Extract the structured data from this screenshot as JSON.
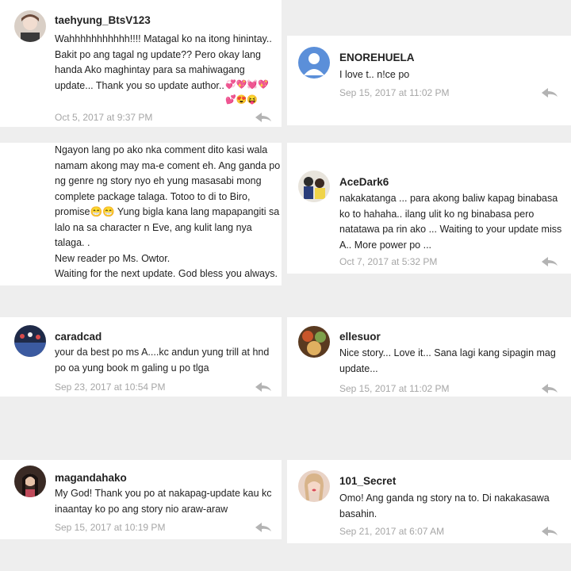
{
  "comments": [
    {
      "username": "taehyung_BtsV123",
      "body": "Wahhhhhhhhhhh!!!!  Matagal ko na itong hinintay..\nBakit po ang tagal ng update??  Pero okay lang\nhanda Ako maghintay para sa mahiwagang\nupdate...  Thank you so update author..",
      "emoji": "💞💖💓💖\n💕😍😝",
      "timestamp": "Oct 5, 2017 at 9:37 PM",
      "avatar_icon": "user-photo"
    },
    {
      "username": "ENOREHUELA",
      "body": "I love t.. n!ce po",
      "timestamp": "Sep 15, 2017 at 11:02 PM",
      "avatar_icon": "default-user-icon"
    },
    {
      "username": "",
      "body": "Ngayon lang po ako nka comment dito kasi wala\nnamam akong may ma-e coment eh. Ang ganda po\nng genre ng story nyo eh yung masasabi mong\ncomplete package talaga. Totoo to di to Biro,\npromise😁😁 Yung bigla kana lang mapapangiti sa\nlalo na sa character n Eve, ang kulit lang nya\ntalaga. .\nNew reader po Ms. Owtor.\nWaiting for the next update. God bless you always.",
      "emoji": "😁😁"
    },
    {
      "username": "AceDark6",
      "body": "nakakatanga ... para akong baliw kapag binabasa\nko to hahaha.. ilang ulit ko ng binabasa pero\nnatatawa pa rin ako ... Waiting to your update miss\nA.. More power po ...",
      "timestamp": "Oct 7, 2017 at 5:32 PM",
      "avatar_icon": "user-photo"
    },
    {
      "username": "caradcad",
      "body": "your da best po ms A....kc andun  yung trill at hnd\npo oa yung book m galing u po tlga",
      "timestamp": "Sep 23, 2017 at 10:54 PM",
      "avatar_icon": "user-photo"
    },
    {
      "username": "ellesuor",
      "body": "Nice story... Love it... Sana lagi kang sipagin mag\nupdate...",
      "timestamp": "Sep 15, 2017 at 11:02 PM",
      "avatar_icon": "user-photo"
    },
    {
      "username": "magandahako",
      "body": "My God! Thank you  po at nakapag-update kau kc\ninaantay ko po ang story nio araw-araw",
      "timestamp": "Sep 15, 2017 at 10:19 PM",
      "avatar_icon": "user-photo"
    },
    {
      "username": "101_Secret",
      "body": "Omo! Ang ganda ng story na to. Di nakakasawa\nbasahin.",
      "timestamp": "Sep 21, 2017 at 6:07 AM",
      "avatar_icon": "user-photo"
    }
  ],
  "colors": {
    "background": "#eeeeee",
    "card": "#ffffff",
    "timestamp": "#a6a6a6",
    "reply_icon": "#b3b3b3",
    "default_avatar": "#5b8fd9"
  }
}
